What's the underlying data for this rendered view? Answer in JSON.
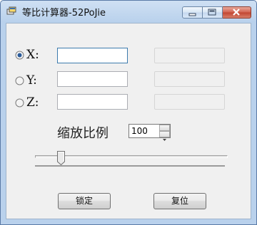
{
  "window": {
    "title": "等比计算器-52PoJie"
  },
  "axes": [
    {
      "key": "x",
      "label": "X:",
      "selected": true,
      "input_value": "",
      "result_value": ""
    },
    {
      "key": "y",
      "label": "Y:",
      "selected": false,
      "input_value": "",
      "result_value": ""
    },
    {
      "key": "z",
      "label": "Z:",
      "selected": false,
      "input_value": "",
      "result_value": ""
    }
  ],
  "scale": {
    "label": "缩放比例",
    "value": "100"
  },
  "slider": {
    "level_fraction": 0.12
  },
  "buttons": {
    "lock": "锁定",
    "reset": "复位"
  },
  "icons": {
    "app": "calculator-app-icon",
    "minimize": "minimize-icon",
    "maximize": "maximize-icon",
    "close": "close-icon",
    "spin_up": "chevron-up-icon",
    "spin_down": "chevron-down-icon"
  },
  "colors": {
    "close_button": "#c75050",
    "radio_selected": "#2b5b9a",
    "titlebar": "#b9d1ec"
  }
}
